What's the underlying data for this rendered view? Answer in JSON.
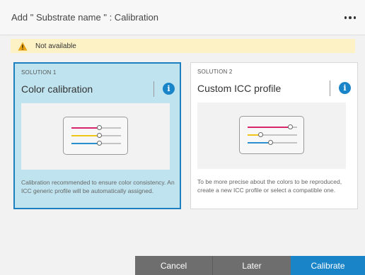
{
  "header": {
    "title": "Add \" Substrate name \" : Calibration"
  },
  "warning": {
    "text": "Not available",
    "icon": "warning-triangle-icon",
    "icon_color": "#e8a317"
  },
  "cards": [
    {
      "label": "SOLUTION 1",
      "title": "Color calibration",
      "description": "Calibration recommended to ensure color consistency. An ICC generic profile will be automatically assigned.",
      "selected": true,
      "sliders": [
        {
          "color": "#d6256b",
          "level": 0.55
        },
        {
          "color": "#f0c419",
          "level": 0.55
        },
        {
          "color": "#2a8fcf",
          "level": 0.55
        }
      ]
    },
    {
      "label": "SOLUTION 2",
      "title": "Custom ICC profile",
      "description": "To be more precise about the colors to be reproduced, create a new ICC profile or select a compatible one.",
      "selected": false,
      "sliders": [
        {
          "color": "#d6256b",
          "level": 0.85
        },
        {
          "color": "#f0c419",
          "level": 0.25
        },
        {
          "color": "#2a8fcf",
          "level": 0.45
        }
      ]
    }
  ],
  "footer": {
    "cancel_label": "Cancel",
    "later_label": "Later",
    "calibrate_label": "Calibrate"
  },
  "colors": {
    "accent": "#1a84c9",
    "selected_bg": "#bfe4ef",
    "footer_gray": "#6e6e6e",
    "warning_bg": "#fdf2c6"
  }
}
